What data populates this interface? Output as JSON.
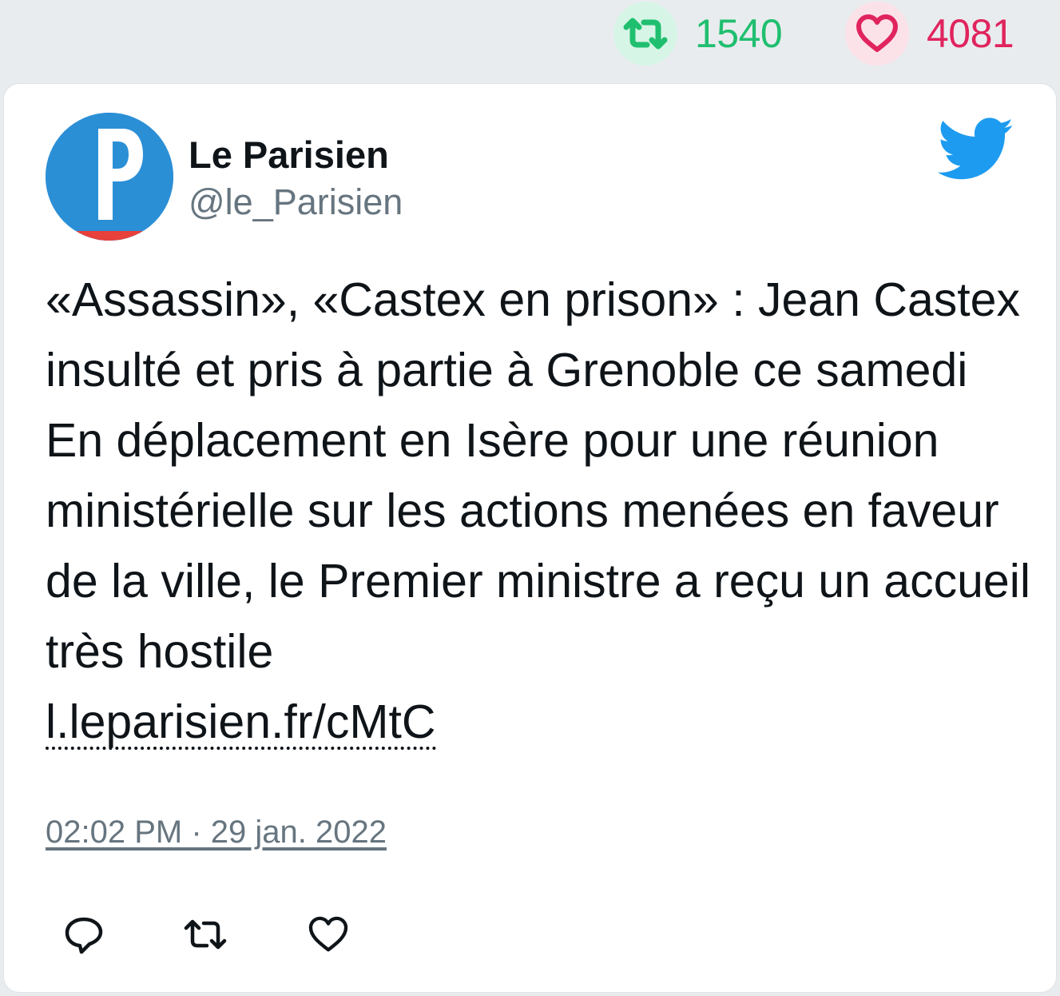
{
  "stats": {
    "retweets": "1540",
    "likes": "4081",
    "retweet_icon": "retweet-icon",
    "like_icon": "heart-icon",
    "colors": {
      "retweet": "#1fbf6f",
      "like": "#e0245e"
    }
  },
  "tweet": {
    "author_name": "Le Parisien",
    "author_handle": "@le_Parisien",
    "avatar_letter": "P",
    "text": "«Assassin», «Castex en prison» : Jean Castex insulté et pris à partie à Grenoble ce samedi En déplacement en Isère pour une réunion ministérielle sur les actions menées en faveur de la ville, le Premier ministre a reçu un accueil très hostile",
    "link": "l.leparisien.fr/cMtC",
    "timestamp": "02:02 PM · 29 jan. 2022",
    "brand_icon": "twitter-bird-icon",
    "brand_color": "#1d9bf0"
  },
  "actions": [
    {
      "name": "reply",
      "icon": "reply-icon"
    },
    {
      "name": "retweet",
      "icon": "retweet-icon"
    },
    {
      "name": "like",
      "icon": "heart-icon"
    }
  ]
}
